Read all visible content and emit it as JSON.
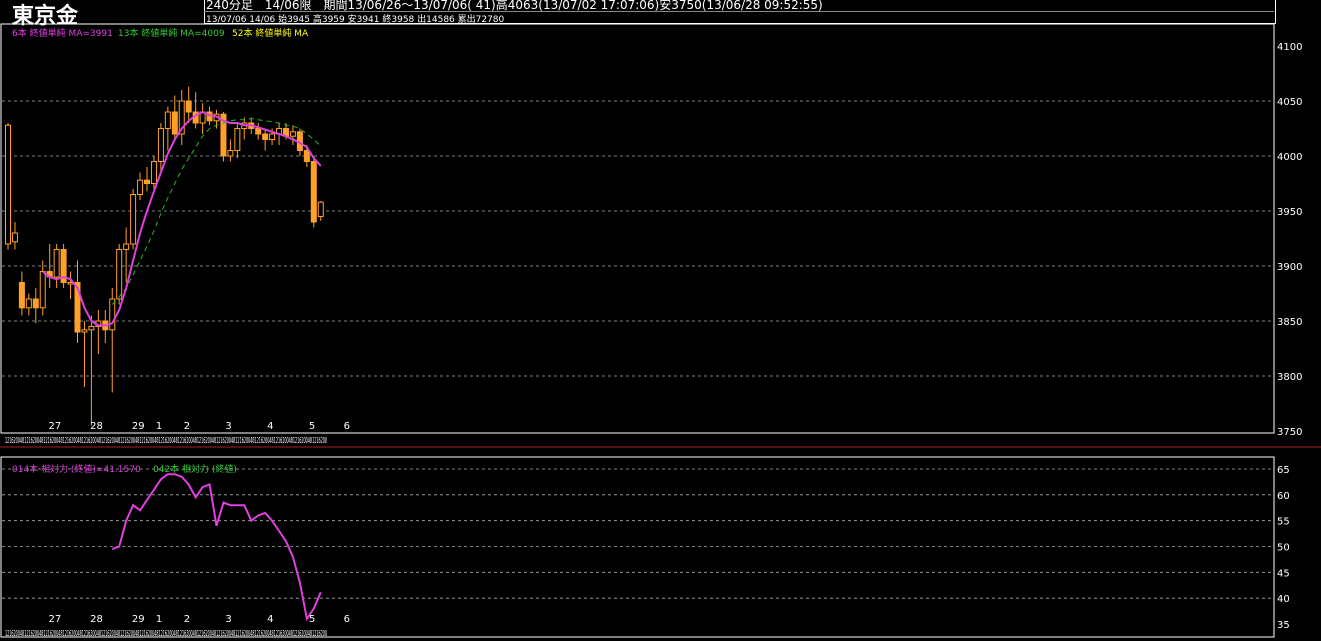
{
  "header": {
    "title": "東京金",
    "line1": "240分足　14/06限　期間13/06/26〜13/07/06(  41)高4063(13/07/02 17:07:06)安3750(13/06/28 09:52:55)",
    "line2": "13/07/06  14/06  始3945  高3959  安3941  終3958  出14586  累出72780"
  },
  "main_legend": [
    {
      "text": "6本 終値単純 MA=3991",
      "color": "#e040e0"
    },
    {
      "text": "13本 終値単純 MA=4009",
      "color": "#33cc33"
    },
    {
      "text": "52本 終値単純 MA",
      "color": "#ffff00"
    }
  ],
  "sub_legend": [
    {
      "text": "014本 相対力 (終値)=41.1570",
      "color": "#e040e0"
    },
    {
      "text": "042本 相対力 (終値)",
      "color": "#33cc33"
    }
  ],
  "colors": {
    "candle": "#ffa028",
    "ma6": "#e040e0",
    "ma13": "#22bb22",
    "rsi": "#e040e0",
    "grid": "#aaaaaa",
    "divider": "#aa2222"
  },
  "chart_data": [
    {
      "type": "candlestick",
      "ylim": [
        3750,
        4100
      ],
      "yticks": [
        "3750",
        "3800",
        "3850",
        "3900",
        "3950",
        "4000",
        "4050",
        "4100"
      ],
      "day_labels": [
        {
          "label": "27",
          "index": 3
        },
        {
          "label": "28",
          "index": 9
        },
        {
          "label": "29",
          "index": 15
        },
        {
          "label": "1",
          "index": 18
        },
        {
          "label": "2",
          "index": 22
        },
        {
          "label": "3",
          "index": 28
        },
        {
          "label": "4",
          "index": 34
        },
        {
          "label": "5",
          "index": 40
        },
        {
          "label": "6",
          "index": 45
        }
      ],
      "hour_labels": [
        "12",
        "16",
        "20",
        "0",
        "4",
        "8",
        "12",
        "16",
        "20",
        "0",
        "4",
        "8",
        "12",
        "16",
        "20",
        "0",
        "4",
        "8",
        "12",
        "16",
        "20",
        "0",
        "4",
        "8",
        "12",
        "16",
        "20",
        "0",
        "4",
        "8",
        "12",
        "16",
        "20",
        "0",
        "4",
        "8",
        "12",
        "16",
        "20",
        "0",
        "4",
        "8",
        "12",
        "16",
        "20",
        "0",
        "4",
        "8",
        "12",
        "16",
        "20",
        "0",
        "4",
        "8",
        "12",
        "16",
        "20",
        "0",
        "4",
        "8",
        "12",
        "16",
        "20",
        "0",
        "4",
        "8",
        "12",
        "16",
        "20",
        "0",
        "4",
        "8",
        "12",
        "16",
        "20",
        "0",
        "4",
        "8",
        "12",
        "16",
        "20",
        "0",
        "4",
        "8",
        "12",
        "16",
        "20",
        "0",
        "4",
        "8",
        "12",
        "16",
        "20",
        "0",
        "4",
        "8",
        "12",
        "16",
        "20",
        "0"
      ],
      "candles": [
        {
          "o": 3920,
          "h": 4030,
          "l": 3915,
          "c": 4028
        },
        {
          "o": 3922,
          "h": 3940,
          "l": 3915,
          "c": 3930
        },
        {
          "o": 3885,
          "h": 3895,
          "l": 3855,
          "c": 3862
        },
        {
          "o": 3862,
          "h": 3875,
          "l": 3855,
          "c": 3870
        },
        {
          "o": 3870,
          "h": 3880,
          "l": 3848,
          "c": 3862
        },
        {
          "o": 3862,
          "h": 3905,
          "l": 3855,
          "c": 3895
        },
        {
          "o": 3895,
          "h": 3920,
          "l": 3880,
          "c": 3890
        },
        {
          "o": 3890,
          "h": 3920,
          "l": 3880,
          "c": 3915
        },
        {
          "o": 3915,
          "h": 3920,
          "l": 3880,
          "c": 3885
        },
        {
          "o": 3885,
          "h": 3895,
          "l": 3870,
          "c": 3885
        },
        {
          "o": 3885,
          "h": 3905,
          "l": 3830,
          "c": 3840
        },
        {
          "o": 3840,
          "h": 3850,
          "l": 3790,
          "c": 3842
        },
        {
          "o": 3842,
          "h": 3855,
          "l": 3755,
          "c": 3845
        },
        {
          "o": 3845,
          "h": 3860,
          "l": 3820,
          "c": 3850
        },
        {
          "o": 3850,
          "h": 3860,
          "l": 3830,
          "c": 3842
        },
        {
          "o": 3842,
          "h": 3880,
          "l": 3785,
          "c": 3870
        },
        {
          "o": 3870,
          "h": 3920,
          "l": 3865,
          "c": 3915
        },
        {
          "o": 3915,
          "h": 3935,
          "l": 3885,
          "c": 3920
        },
        {
          "o": 3920,
          "h": 3970,
          "l": 3915,
          "c": 3965
        },
        {
          "o": 3965,
          "h": 3985,
          "l": 3960,
          "c": 3978
        },
        {
          "o": 3978,
          "h": 3990,
          "l": 3968,
          "c": 3975
        },
        {
          "o": 3975,
          "h": 4000,
          "l": 3970,
          "c": 3995
        },
        {
          "o": 3995,
          "h": 4030,
          "l": 3985,
          "c": 4025
        },
        {
          "o": 4025,
          "h": 4045,
          "l": 4005,
          "c": 4040
        },
        {
          "o": 4040,
          "h": 4055,
          "l": 4015,
          "c": 4020
        },
        {
          "o": 4020,
          "h": 4060,
          "l": 4010,
          "c": 4050
        },
        {
          "o": 4050,
          "h": 4063,
          "l": 4030,
          "c": 4040
        },
        {
          "o": 4040,
          "h": 4058,
          "l": 4025,
          "c": 4030
        },
        {
          "o": 4030,
          "h": 4048,
          "l": 4020,
          "c": 4040
        },
        {
          "o": 4040,
          "h": 4045,
          "l": 4028,
          "c": 4032
        },
        {
          "o": 4032,
          "h": 4042,
          "l": 4025,
          "c": 4038
        },
        {
          "o": 4038,
          "h": 4040,
          "l": 3995,
          "c": 4000
        },
        {
          "o": 4000,
          "h": 4015,
          "l": 3995,
          "c": 4005
        },
        {
          "o": 4005,
          "h": 4030,
          "l": 3998,
          "c": 4025
        },
        {
          "o": 4025,
          "h": 4035,
          "l": 4015,
          "c": 4030
        },
        {
          "o": 4030,
          "h": 4035,
          "l": 4020,
          "c": 4025
        },
        {
          "o": 4025,
          "h": 4030,
          "l": 4015,
          "c": 4020
        },
        {
          "o": 4020,
          "h": 4025,
          "l": 4005,
          "c": 4015
        },
        {
          "o": 4015,
          "h": 4025,
          "l": 4010,
          "c": 4020
        },
        {
          "o": 4020,
          "h": 4030,
          "l": 4010,
          "c": 4025
        },
        {
          "o": 4025,
          "h": 4030,
          "l": 4015,
          "c": 4018
        },
        {
          "o": 4018,
          "h": 4028,
          "l": 4010,
          "c": 4022
        },
        {
          "o": 4022,
          "h": 4025,
          "l": 4000,
          "c": 4005
        },
        {
          "o": 4005,
          "h": 4010,
          "l": 3990,
          "c": 3995
        },
        {
          "o": 3995,
          "h": 4000,
          "l": 3935,
          "c": 3940
        },
        {
          "o": 3945,
          "h": 3959,
          "l": 3941,
          "c": 3958
        }
      ],
      "ma6": [
        null,
        null,
        null,
        null,
        null,
        3895,
        3890,
        3888,
        3890,
        3888,
        3880,
        3862,
        3850,
        3846,
        3846,
        3848,
        3860,
        3880,
        3905,
        3930,
        3950,
        3968,
        3985,
        4002,
        4015,
        4025,
        4032,
        4037,
        4040,
        4037,
        4036,
        4032,
        4030,
        4030,
        4028,
        4028,
        4026,
        4024,
        4022,
        4020,
        4018,
        4015,
        4012,
        4008,
        3998,
        3991
      ],
      "ma13": [
        null,
        null,
        null,
        null,
        null,
        null,
        null,
        null,
        null,
        null,
        null,
        null,
        null,
        null,
        null,
        3865,
        3872,
        3880,
        3892,
        3905,
        3918,
        3932,
        3948,
        3962,
        3975,
        3988,
        3998,
        4008,
        4018,
        4025,
        4028,
        4030,
        4032,
        4033,
        4033,
        4034,
        4033,
        4032,
        4031,
        4030,
        4028,
        4027,
        4025,
        4020,
        4015,
        4009
      ]
    },
    {
      "type": "line",
      "ylim": [
        35,
        65
      ],
      "yticks": [
        "35",
        "40",
        "45",
        "50",
        "55",
        "60",
        "65"
      ],
      "rsi14": [
        null,
        null,
        null,
        null,
        null,
        null,
        null,
        null,
        null,
        null,
        null,
        null,
        null,
        null,
        null,
        49.5,
        50,
        55,
        58,
        57,
        59,
        61,
        63,
        64,
        64,
        63.5,
        62,
        59.5,
        61.5,
        62,
        54,
        58.5,
        58,
        58,
        58,
        55,
        56,
        56.5,
        55,
        53,
        51,
        48,
        43,
        36,
        38,
        41.157
      ]
    }
  ]
}
